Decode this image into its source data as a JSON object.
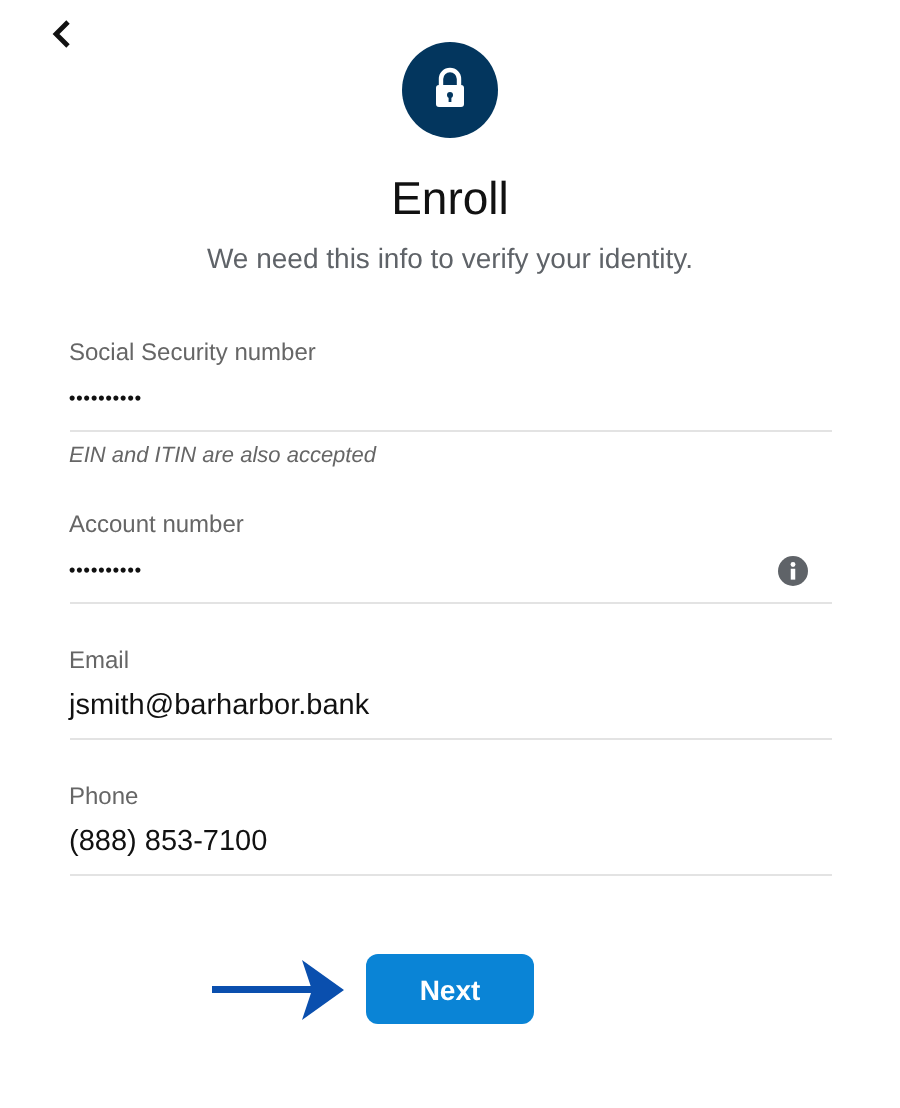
{
  "title": "Enroll",
  "subtitle": "We need this info to verify your identity.",
  "fields": [
    {
      "label": "Social Security number",
      "value": "••••••••••",
      "kind": "masked",
      "hint": "EIN and ITIN are also accepted",
      "info": false
    },
    {
      "label": "Account number",
      "value": "••••••••••",
      "kind": "masked",
      "info": true
    },
    {
      "label": "Email",
      "value": "jsmith@barharbor.bank",
      "kind": "text",
      "info": false
    },
    {
      "label": "Phone",
      "value": "(888) 853-7100",
      "kind": "text",
      "info": false
    }
  ],
  "button": {
    "label": "Next"
  }
}
